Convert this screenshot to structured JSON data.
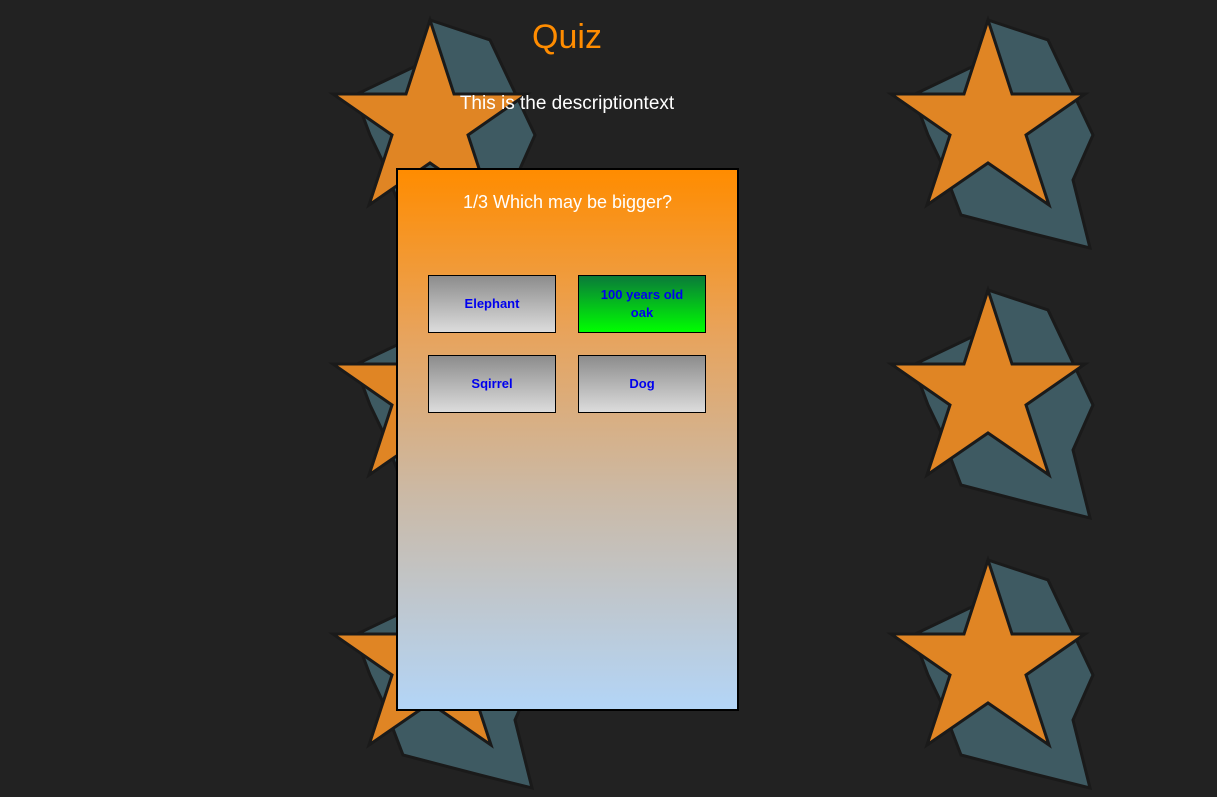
{
  "title": "Quiz",
  "description": "This is the descriptiontext",
  "question": {
    "text": "1/3 Which may be bigger?"
  },
  "answers": [
    {
      "label": "Elephant"
    },
    {
      "label": "100 years old oak"
    },
    {
      "label": "Sqirrel"
    },
    {
      "label": "Dog"
    }
  ],
  "colors": {
    "background": "#222222",
    "accent": "#ff8c00",
    "star_fill": "#e08524",
    "star_side": "#3e5a62",
    "correct": "#00ff00",
    "answer_text": "#0000ee"
  },
  "icons": {
    "background_decoration": "star-icon"
  }
}
